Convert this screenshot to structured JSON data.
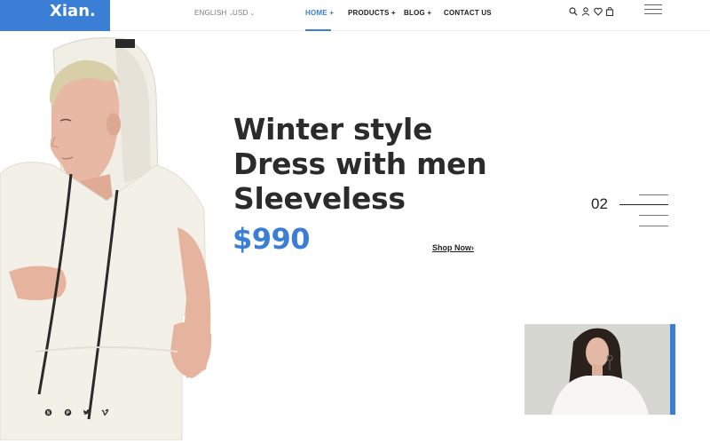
{
  "header": {
    "logo": "Xian.",
    "language": "ENGLISH",
    "currency": "USD",
    "nav": [
      {
        "label": "HOME +"
      },
      {
        "label": "PRODUCTS +"
      },
      {
        "label": "BLOG +"
      },
      {
        "label": "CONTACT US"
      }
    ],
    "icons": [
      "search-icon",
      "user-icon",
      "heart-icon",
      "bag-icon",
      "menu-icon"
    ]
  },
  "hero": {
    "title_lines": [
      "Winter style",
      "Dress with men",
      "Sleeveless"
    ],
    "price": "$990",
    "cta": "Shop Now",
    "cta_arrow": "›",
    "slide_number": "02"
  },
  "social": [
    "skype-icon",
    "pinterest-icon",
    "twitter-icon",
    "vimeo-icon"
  ],
  "colors": {
    "accent": "#3a7fd5",
    "text": "#2b2b2b"
  }
}
